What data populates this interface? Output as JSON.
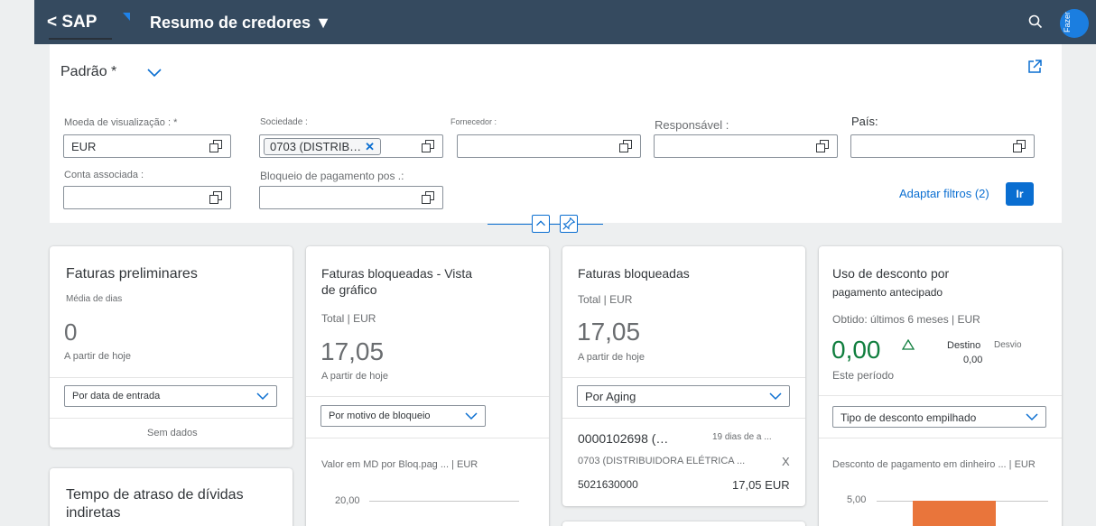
{
  "shell": {
    "back_label": "< SAP",
    "title": "Resumo de credores ▼",
    "avatar_text": "Fazer"
  },
  "filterbar": {
    "variant": "Padrão *",
    "fields": {
      "moeda": {
        "label": "Moeda de visualização : *",
        "value": "EUR"
      },
      "sociedade": {
        "label": "Sociedade :",
        "token": "0703 (DISTRIB…"
      },
      "fornecedor": {
        "label": "Fornecedor :",
        "value": ""
      },
      "responsavel": {
        "label": "Responsável :",
        "value": ""
      },
      "pais": {
        "label": "País:",
        "value": ""
      },
      "conta": {
        "label": "Conta associada :",
        "value": ""
      },
      "bloqueio": {
        "label": "Bloqueio de pagamento pos .:",
        "value": ""
      }
    },
    "adapt_label": "Adaptar filtros (2)",
    "go_label": "Ir"
  },
  "cards": {
    "preliminares": {
      "title": "Faturas preliminares",
      "subtitle": "Média de dias",
      "kpi": "0",
      "note": "A partir de hoje",
      "select": "Por data de entrada",
      "footer": "Sem dados"
    },
    "atraso": {
      "title_line1": "Tempo de atraso de dívidas",
      "title_line2": "indiretas"
    },
    "bloq_grafico": {
      "title_line1": "Faturas bloqueadas - Vista",
      "title_line2": "de gráfico",
      "subtitle": "Total | EUR",
      "kpi": "17,05",
      "note": "A partir de hoje",
      "select": "Por motivo de bloqueio",
      "chart_title": "Valor em MD por Bloq.pag ... | EUR",
      "axis_tick": "20,00"
    },
    "bloqueadas": {
      "title": "Faturas bloqueadas",
      "subtitle": "Total | EUR",
      "kpi": "17,05",
      "note": "A partir de hoje",
      "select": "Por Aging",
      "item": {
        "id": "0000102698 (…",
        "days": "19 dias de a ...",
        "company": "0703 (DISTRIBUIDORA ELÉTRICA ...",
        "x": "X",
        "doc": "5021630000",
        "amount": "17,05 EUR"
      }
    },
    "desconto": {
      "title_line1": "Uso de desconto por",
      "title_line2": "pagamento antecipado",
      "subtitle": "Obtido: últimos 6 meses | EUR",
      "kpi": "0,00",
      "destino_label": "Destino",
      "destino_value": "0,00",
      "desvio_label": "Desvio",
      "period": "Este período",
      "select": "Tipo de desconto empilhado",
      "chart_title": "Desconto de pagamento em dinheiro ... | EUR",
      "axis_tick": "5,00"
    }
  },
  "colors": {
    "shell": "#354a5f",
    "accent": "#0a6ed1",
    "positive": "#107e3e",
    "bar": "#e9753b"
  }
}
